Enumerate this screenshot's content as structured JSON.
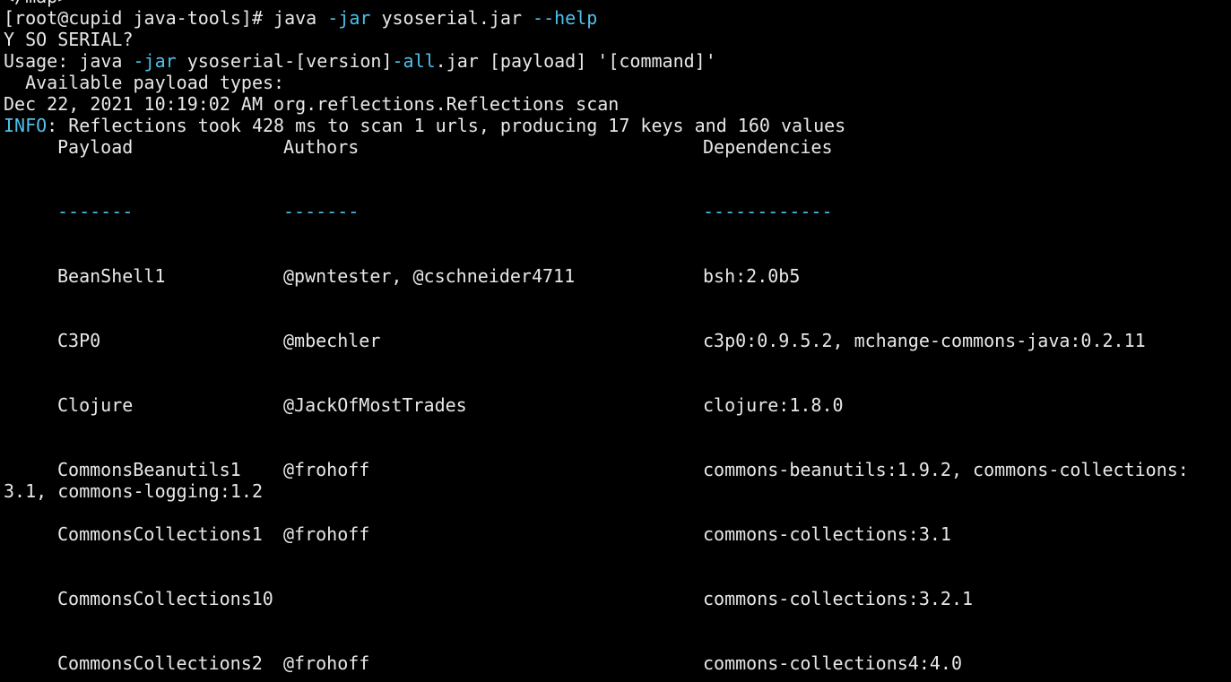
{
  "terminal": {
    "partial_top": "</map>",
    "prompt": "[root@cupid java-tools]# ",
    "cmd_java": "java ",
    "cmd_flag_jar": "-jar",
    "cmd_file": " ysoserial.jar ",
    "cmd_flag_help": "--help",
    "banner": "Y SO SERIAL?",
    "usage_pre": "Usage: java ",
    "usage_flag_jar": "-jar",
    "usage_mid": " ysoserial-[version]",
    "usage_flag_all": "-all",
    "usage_post": ".jar [payload] '[command]'",
    "available": "  Available payload types:",
    "log_date": "Dec 22, 2021 10:19:02 AM org.reflections.Reflections scan",
    "info_label": "INFO",
    "info_text": ": Reflections took 428 ms to scan 1 urls, producing 17 keys and 160 values"
  },
  "table": {
    "headers": {
      "payload": "Payload",
      "authors": "Authors",
      "deps": "Dependencies"
    },
    "separators": {
      "payload": "-------",
      "authors": "-------",
      "deps": "------------"
    },
    "rows": [
      {
        "payload": "BeanShell1",
        "authors": "@pwntester, @cschneider4711",
        "deps": "bsh:2.0b5",
        "wrap": ""
      },
      {
        "payload": "C3P0",
        "authors": "@mbechler",
        "deps": "c3p0:0.9.5.2, mchange-commons-java:0.2.11",
        "wrap": ""
      },
      {
        "payload": "Clojure",
        "authors": "@JackOfMostTrades",
        "deps": "clojure:1.8.0",
        "wrap": ""
      },
      {
        "payload": "CommonsBeanutils1",
        "authors": "@frohoff",
        "deps": "commons-beanutils:1.9.2, commons-collections:",
        "wrap": "3.1, commons-logging:1.2"
      },
      {
        "payload": "CommonsCollections1",
        "authors": "@frohoff",
        "deps": "commons-collections:3.1",
        "wrap": ""
      },
      {
        "payload": "CommonsCollections10",
        "authors": "",
        "deps": "commons-collections:3.2.1",
        "wrap": ""
      },
      {
        "payload": "CommonsCollections2",
        "authors": "@frohoff",
        "deps": "commons-collections4:4.0",
        "wrap": ""
      }
    ]
  },
  "colors": {
    "background": "#000000",
    "text": "#e8e8e8",
    "accent_cyan": "#4fc1e9"
  }
}
